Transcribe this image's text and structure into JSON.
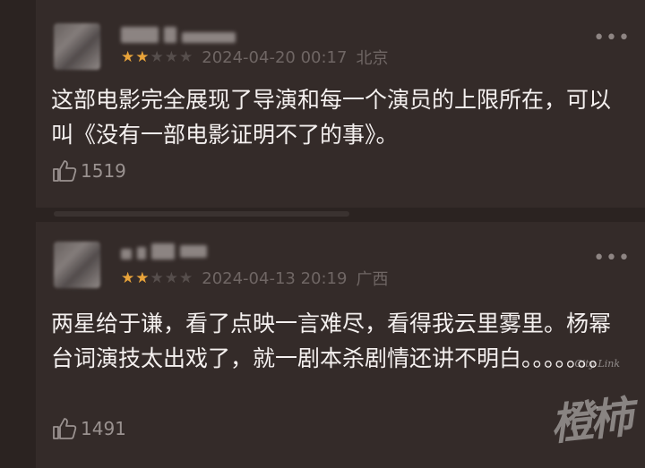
{
  "reviews": [
    {
      "date": "2024-04-20 00:17",
      "location": "北京",
      "rating": 2,
      "text": "这部电影完全展现了导演和每一个演员的上限所在，可以叫《没有一部电影证明不了的事》。",
      "likes": "1519"
    },
    {
      "date": "2024-04-13 20:19",
      "location": "广西",
      "rating": 2,
      "text": "两星给于谦，看了点映一言难尽，看得我云里雾里。杨幂台词演技太出戏了，就一剧本杀剧情还讲不明白。。。。。。。",
      "likes": "1491"
    }
  ],
  "more_glyph": "•••",
  "watermark": {
    "text": "橙柿",
    "sub": "City Link"
  },
  "colors": {
    "background": "#2b2321",
    "card": "#342b29",
    "star_on": "#e8a33a",
    "star_off": "#564e4c",
    "meta_text": "#6f6664"
  },
  "icons": {
    "like": "thumbs-up-icon",
    "more": "more-dots-icon",
    "star": "star-icon"
  }
}
